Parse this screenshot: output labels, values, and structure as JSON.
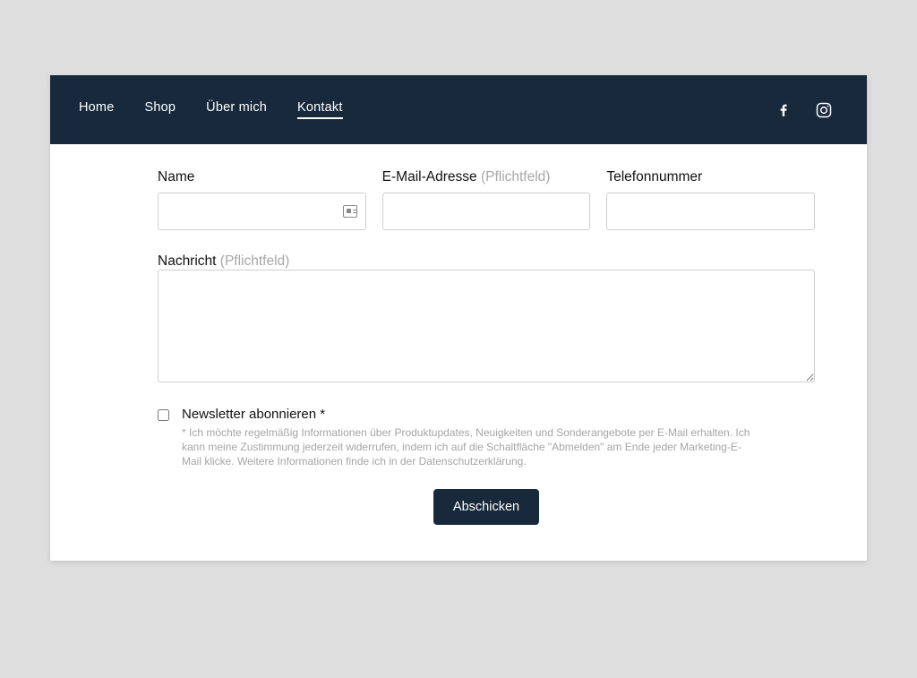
{
  "nav": {
    "items": [
      {
        "label": "Home",
        "active": false
      },
      {
        "label": "Shop",
        "active": false
      },
      {
        "label": "Über mich",
        "active": false
      },
      {
        "label": "Kontakt",
        "active": true
      }
    ]
  },
  "form": {
    "name": {
      "label": "Name",
      "value": ""
    },
    "email": {
      "label": "E-Mail-Adresse",
      "required_hint": "(Pflichtfeld)",
      "value": ""
    },
    "phone": {
      "label": "Telefonnummer",
      "value": ""
    },
    "message": {
      "label": "Nachricht",
      "required_hint": "(Pflichtfeld)",
      "value": ""
    },
    "newsletter": {
      "label": "Newsletter abonnieren *",
      "checked": false,
      "fineprint": "* Ich möchte regelmäßig Informationen über Produktupdates, Neuigkeiten und Sonderangebote per E-Mail erhalten. Ich kann meine Zustimmung jederzeit widerrufen, indem ich auf die Schaltfläche \"Abmelden\" am Ende jeder Marketing-E-Mail klicke. Weitere Informationen finde ich in der Datenschutzerklärung."
    },
    "submit_label": "Abschicken"
  },
  "colors": {
    "navbar_bg": "#18293b",
    "page_bg": "#dedede"
  }
}
